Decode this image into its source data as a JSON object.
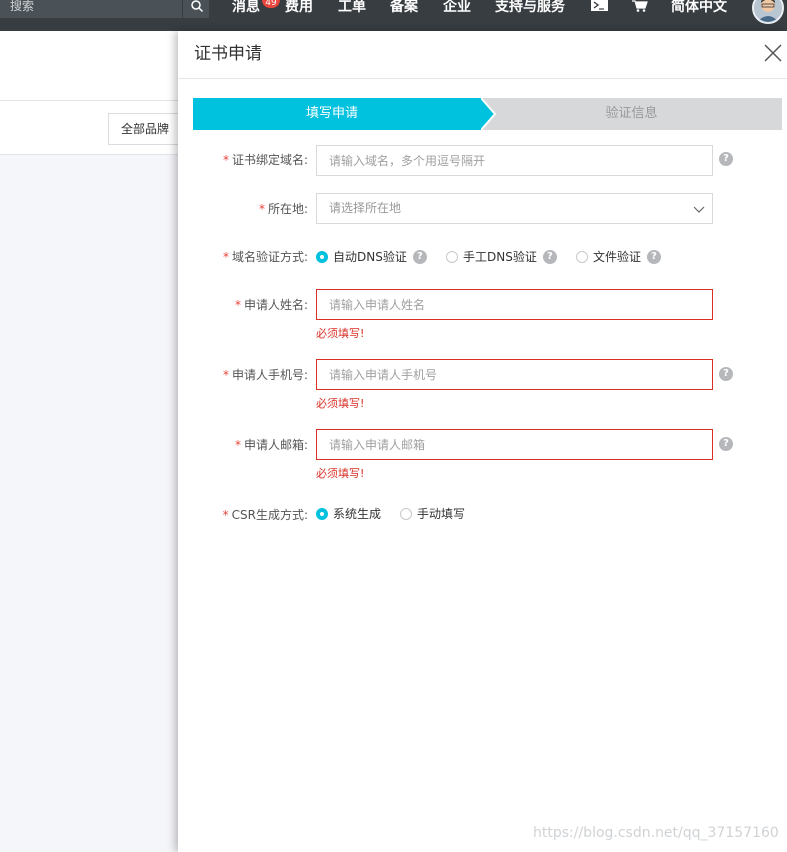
{
  "topbar": {
    "search_label": "搜索",
    "message_label": "消息",
    "message_badge": "49",
    "fees_label": "费用",
    "tickets_label": "工单",
    "filing_label": "备案",
    "enterprise_label": "企业",
    "support_label": "支持与服务",
    "language_label": "简体中文"
  },
  "background": {
    "brand_filter_label": "全部品牌"
  },
  "drawer": {
    "title": "证书申请",
    "steps": [
      {
        "label": "填写申请",
        "active": true
      },
      {
        "label": "验证信息",
        "active": false
      }
    ],
    "form": {
      "domain": {
        "label": "证书绑定域名:",
        "placeholder": "请输入域名，多个用逗号隔开"
      },
      "location": {
        "label": "所在地:",
        "placeholder": "请选择所在地"
      },
      "verify_method": {
        "label": "域名验证方式:",
        "options": [
          "自动DNS验证",
          "手工DNS验证",
          "文件验证"
        ],
        "selected": "自动DNS验证"
      },
      "applicant_name": {
        "label": "申请人姓名:",
        "placeholder": "请输入申请人姓名",
        "error": "必须填写!"
      },
      "applicant_phone": {
        "label": "申请人手机号:",
        "placeholder": "请输入申请人手机号",
        "error": "必须填写!"
      },
      "applicant_email": {
        "label": "申请人邮箱:",
        "placeholder": "请输入申请人邮箱",
        "error": "必须填写!"
      },
      "csr_method": {
        "label": "CSR生成方式:",
        "options": [
          "系统生成",
          "手动填写"
        ],
        "selected": "系统生成"
      }
    },
    "required_mark": "*",
    "help_glyph": "?"
  },
  "watermark": "https://blog.csdn.net/qq_37157160",
  "colors": {
    "accent": "#00c1de",
    "error": "#d93026",
    "topbar": "#373d41"
  }
}
